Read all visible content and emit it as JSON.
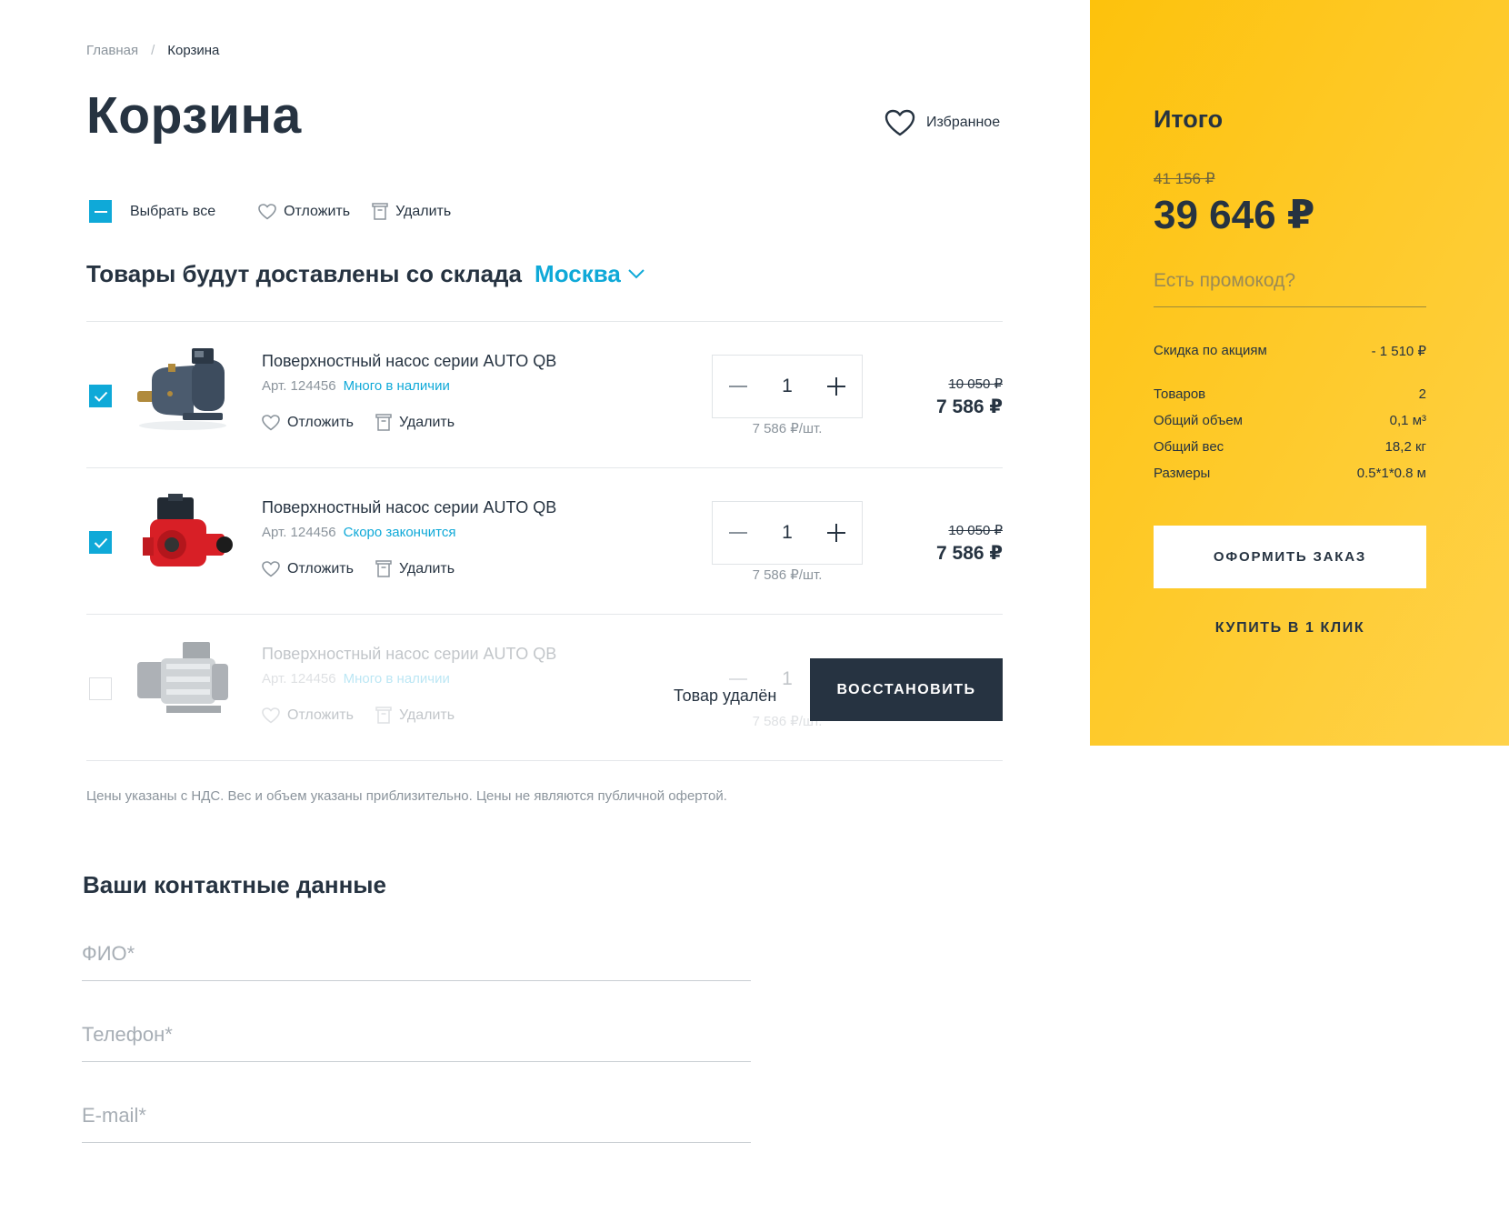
{
  "breadcrumb": {
    "home": "Главная",
    "separator": "/",
    "current": "Корзина"
  },
  "page": {
    "title": "Корзина",
    "favorites_label": "Избранное"
  },
  "toolbar": {
    "select_all": "Выбрать все",
    "postpone": "Отложить",
    "delete": "Удалить"
  },
  "warehouse": {
    "label": "Товары будут доставлены со склада",
    "city": "Москва"
  },
  "items": [
    {
      "name": "Поверхностный насос серии AUTO QB",
      "sku": "Арт. 124456",
      "stock": "Много в наличии",
      "postpone": "Отложить",
      "delete": "Удалить",
      "qty": "1",
      "unit_price": "7 586 ₽/шт.",
      "old_price": "10 050 ₽",
      "price": "7 586 ₽",
      "checked": true,
      "product_color": "#46566a"
    },
    {
      "name": "Поверхностный насос серии AUTO QB",
      "sku": "Арт. 124456",
      "stock": "Скоро закончится",
      "postpone": "Отложить",
      "delete": "Удалить",
      "qty": "1",
      "unit_price": "7 586 ₽/шт.",
      "old_price": "10 050 ₽",
      "price": "7 586 ₽",
      "checked": true,
      "product_color": "#d81f26"
    },
    {
      "name": "Поверхностный насос серии AUTO QB",
      "sku": "Арт. 124456",
      "stock": "Много в наличии",
      "postpone": "Отложить",
      "delete": "Удалить",
      "qty": "1",
      "unit_price": "7 586 ₽/шт.",
      "checked": false,
      "removed": true,
      "removed_label": "Товар удалён",
      "restore_label": "ВОССТАНОВИТЬ",
      "product_color": "#8a9096"
    }
  ],
  "note": "Цены указаны с НДС. Вес и объем указаны приблизительно. Цены не являются публичной офертой.",
  "contacts": {
    "title": "Ваши контактные данные",
    "name_placeholder": "ФИО*",
    "phone_placeholder": "Телефон*",
    "email_placeholder": "E-mail*"
  },
  "summary": {
    "title": "Итого",
    "old_total": "41 156 ₽",
    "total": "39 646 ₽",
    "promo_placeholder": "Есть промокод?",
    "discount_label": "Скидка по акциям",
    "discount_value": "- 1 510 ₽",
    "items_label": "Товаров",
    "items_value": "2",
    "volume_label": "Общий объем",
    "volume_value": "0,1 м³",
    "weight_label": "Общий вес",
    "weight_value": "18,2 кг",
    "size_label": "Размеры",
    "size_value": "0.5*1*0.8 м",
    "order_button": "ОФОРМИТЬ ЗАКАЗ",
    "oneclick": "КУПИТЬ В 1 КЛИК"
  },
  "colors": {
    "accent": "#0fa9d8",
    "dark": "#263341",
    "summary_bg": "#fdc20c"
  }
}
